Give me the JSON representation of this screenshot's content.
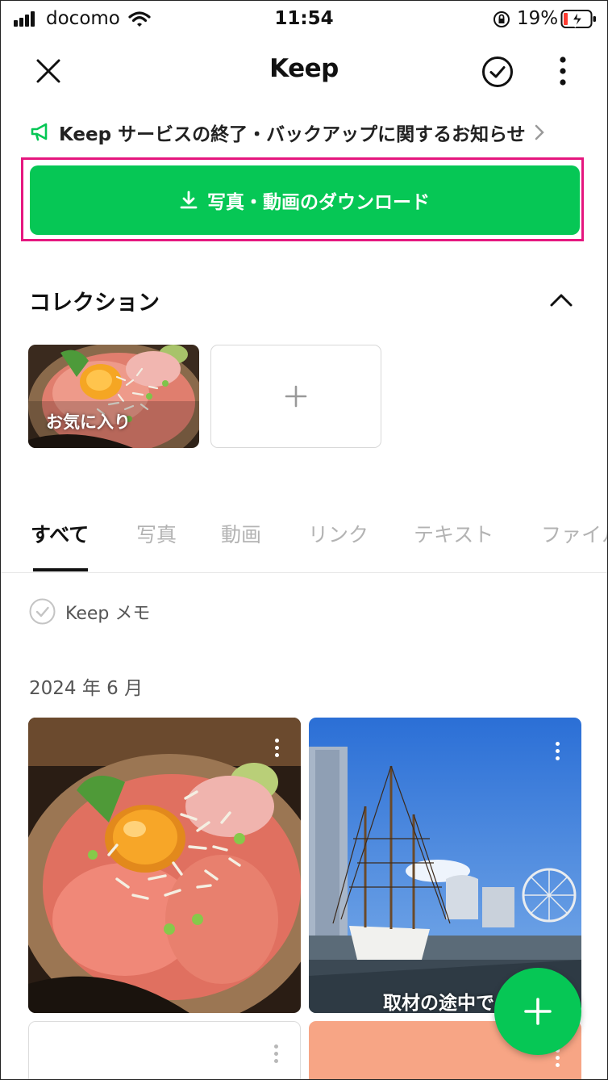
{
  "status_bar": {
    "carrier": "docomo",
    "time": "11:54",
    "battery_percent": "19%"
  },
  "header": {
    "title": "Keep",
    "close_icon": "close-icon",
    "check_icon": "check-circle-icon",
    "more_icon": "more-vertical-icon"
  },
  "notice": {
    "text": "Keep サービスの終了・バックアップに関するお知らせ",
    "icon": "megaphone-icon"
  },
  "download_button": {
    "label": "写真・動画のダウンロード",
    "icon": "download-icon"
  },
  "collections": {
    "title": "コレクション",
    "items": [
      {
        "label": "お気に入り"
      }
    ]
  },
  "tabs": [
    {
      "label": "すべて",
      "active": true
    },
    {
      "label": "写真"
    },
    {
      "label": "動画"
    },
    {
      "label": "リンク"
    },
    {
      "label": "テキスト"
    },
    {
      "label": "ファイル"
    }
  ],
  "keep_memo": {
    "label": "Keep メモ"
  },
  "section_date": "2024 年 6 月",
  "items": [
    {
      "type": "photo",
      "subject": "food bowl"
    },
    {
      "type": "photo",
      "subject": "tall ship harbor",
      "caption": "取材の途中で"
    }
  ],
  "colors": {
    "accent_green": "#06c755",
    "highlight_magenta": "#e5177f",
    "salmon_card": "#f7a585"
  }
}
